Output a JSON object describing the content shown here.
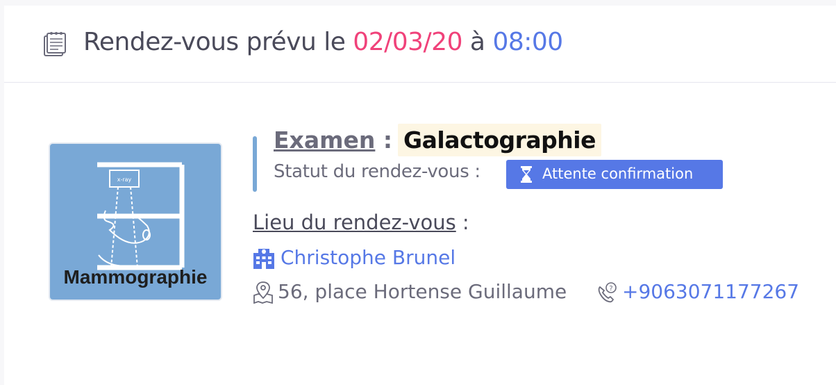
{
  "header": {
    "prefix": "Rendez-vous prévu le ",
    "date": "02/03/20",
    "joiner": " à ",
    "time": "08:00",
    "icon": "notepad-icon"
  },
  "exam": {
    "key": "Examen",
    "separator": " :",
    "value": "Galactographie",
    "image_label": "Mammographie",
    "image_text": "x-ray"
  },
  "status": {
    "label": "Statut du rendez-vous :",
    "badge": "Attente confirmation",
    "badge_icon": "hourglass-icon"
  },
  "location": {
    "key": "Lieu du rendez-vous",
    "separator": " :",
    "clinic": "Christophe Brunel",
    "address": "56, place Hortense Guillaume",
    "phone": "+9063071177267"
  },
  "colors": {
    "date": "#f0427a",
    "time": "#5678e6",
    "accent": "#5678e6",
    "image_bg": "#79a8d6",
    "highlight": "#fdf6e3"
  }
}
